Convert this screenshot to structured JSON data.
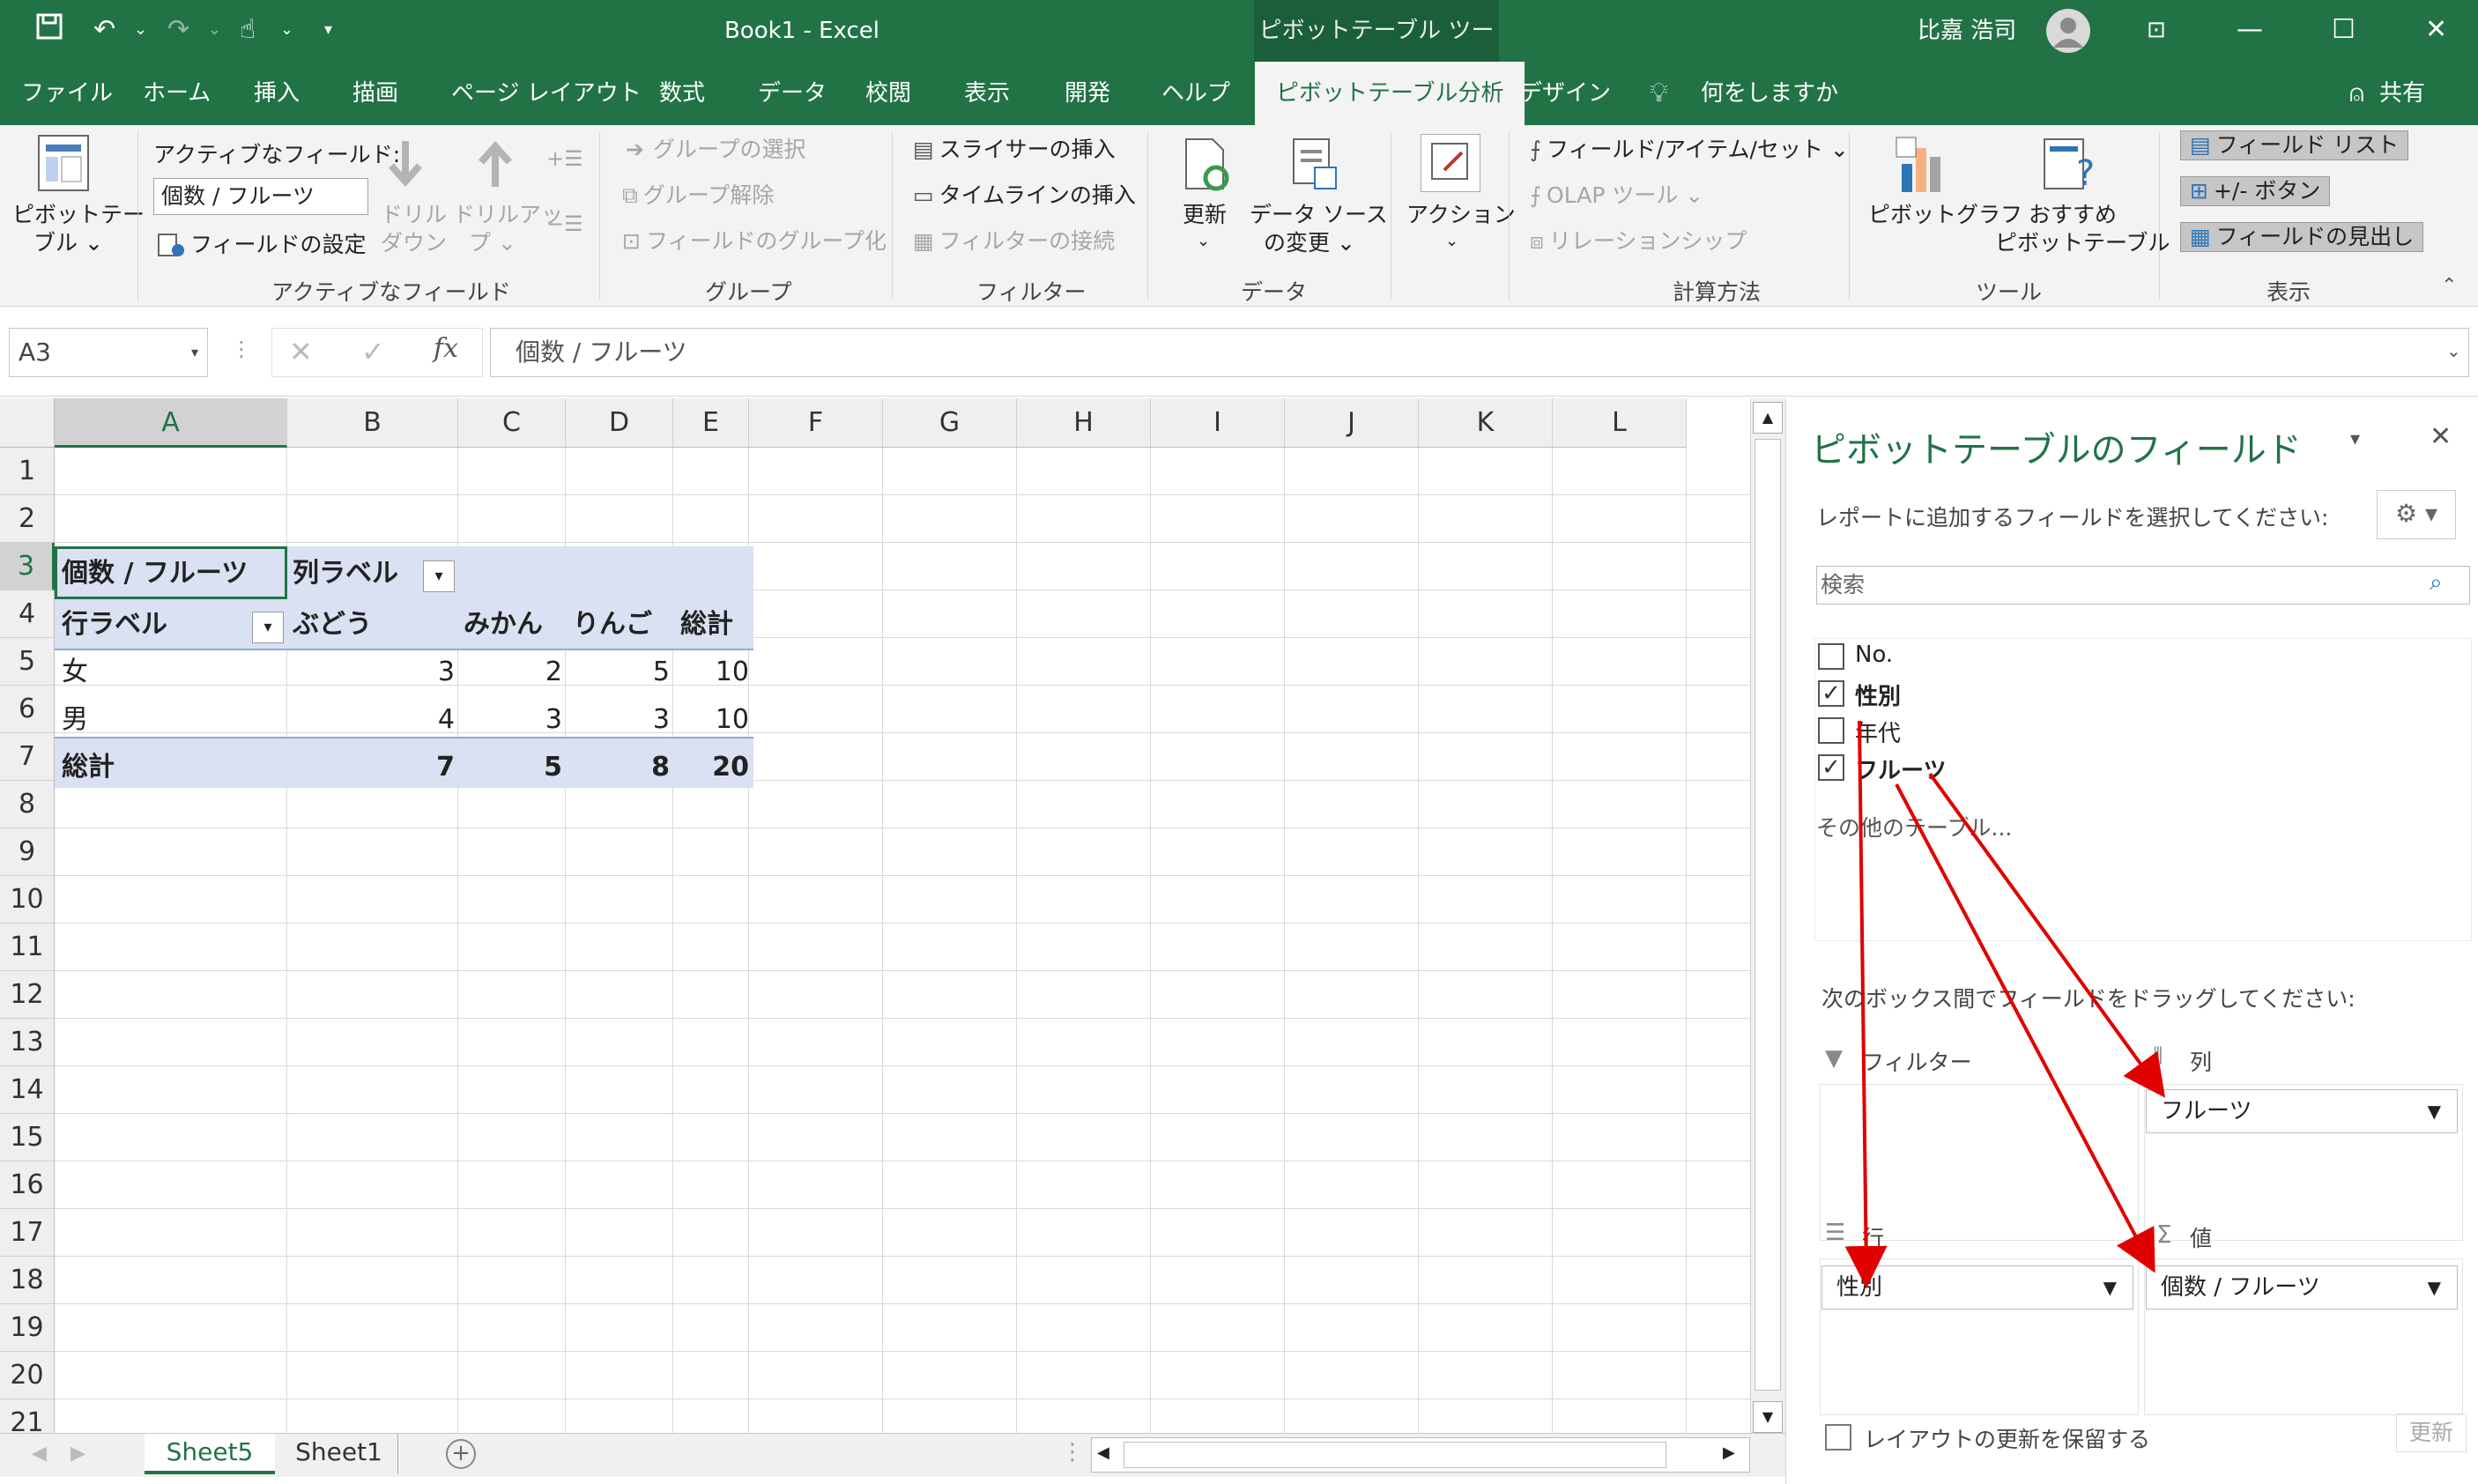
{
  "title_bar": {
    "title": "Book1  -  Excel",
    "context_tab": "ピボットテーブル ツール",
    "user": "比嘉 浩司"
  },
  "tabs": [
    "ファイル",
    "ホーム",
    "挿入",
    "描画",
    "ページ レイアウト",
    "数式",
    "データ",
    "校閲",
    "表示",
    "開発",
    "ヘルプ",
    "ピボットテーブル分析",
    "デザイン"
  ],
  "tell_me": "何をしますか",
  "share": "共有",
  "ribbon": {
    "pivot_table": [
      "ピボットテー",
      "ブル ⌄"
    ],
    "active_field_label": "アクティブなフィールド:",
    "active_field_value": "個数 / フルーツ",
    "field_settings": "フィールドの設定",
    "drill_down": [
      "ドリル",
      "ダウン"
    ],
    "drill_up": [
      "ドリルアッ",
      "プ ⌄"
    ],
    "group_active": "アクティブなフィールド",
    "group_select": "グループの選択",
    "group_ungroup": "グループ解除",
    "group_field": "フィールドのグループ化",
    "group_group": "グループ",
    "slicer": "スライサーの挿入",
    "timeline": "タイムラインの挿入",
    "filter_conn": "フィルターの接続",
    "group_filter": "フィルター",
    "refresh": [
      "更新",
      "⌄"
    ],
    "change_source": [
      "データ ソース",
      "の変更 ⌄"
    ],
    "group_data": "データ",
    "action": [
      "アクション",
      "⌄"
    ],
    "fields_items": "フィールド/アイテム/セット ⌄",
    "olap": "OLAP ツール ⌄",
    "relations": "リレーションシップ",
    "group_calc": "計算方法",
    "pivot_chart": "ピボットグラフ",
    "recommended": [
      "おすすめ",
      "ピボットテーブル"
    ],
    "group_tools": "ツール",
    "field_list": "フィールド リスト",
    "plus_minus": "+/- ボタン",
    "field_headers": "フィールドの見出し",
    "group_show": "表示"
  },
  "formula_bar": {
    "name_box": "A3",
    "formula": "個数 / フルーツ",
    "fx": "fx"
  },
  "columns": [
    "A",
    "B",
    "C",
    "D",
    "E",
    "F",
    "G",
    "H",
    "I",
    "J",
    "K",
    "L"
  ],
  "rows": [
    "1",
    "2",
    "3",
    "4",
    "5",
    "6",
    "7",
    "8",
    "9",
    "10",
    "11",
    "12",
    "13",
    "14",
    "15",
    "16",
    "17",
    "18",
    "19",
    "20",
    "21"
  ],
  "pivot": {
    "title": "個数 / フルーツ",
    "col_label": "列ラベル",
    "row_label": "行ラベル",
    "headers": [
      "ぶどう",
      "みかん",
      "りんご",
      "総計"
    ],
    "rows": [
      {
        "label": "女",
        "values": [
          "3",
          "2",
          "5",
          "10"
        ]
      },
      {
        "label": "男",
        "values": [
          "4",
          "3",
          "3",
          "10"
        ]
      }
    ],
    "total": {
      "label": "総計",
      "values": [
        "7",
        "5",
        "8",
        "20"
      ]
    }
  },
  "sheet_tabs": [
    "Sheet5",
    "Sheet1"
  ],
  "pane": {
    "title": "ピボットテーブルのフィールド",
    "subtitle": "レポートに追加するフィールドを選択してください:",
    "search_placeholder": "検索",
    "fields": [
      {
        "name": "No.",
        "checked": false
      },
      {
        "name": "性別",
        "checked": true
      },
      {
        "name": "年代",
        "checked": false
      },
      {
        "name": "フルーツ",
        "checked": true
      }
    ],
    "more_tables": "その他のテーブル...",
    "drag_hint": "次のボックス間でフィールドをドラッグしてください:",
    "area_filter": "フィルター",
    "area_columns": "列",
    "area_rows": "行",
    "area_values": "値",
    "columns_item": "フルーツ",
    "rows_item": "性別",
    "values_item": "個数 / フルーツ",
    "defer": "レイアウトの更新を保留する",
    "update": "更新"
  },
  "colors": {
    "excel_green": "#217346",
    "pivot_header": "#d9e1f2",
    "annotation_arrow": "#e00000"
  }
}
